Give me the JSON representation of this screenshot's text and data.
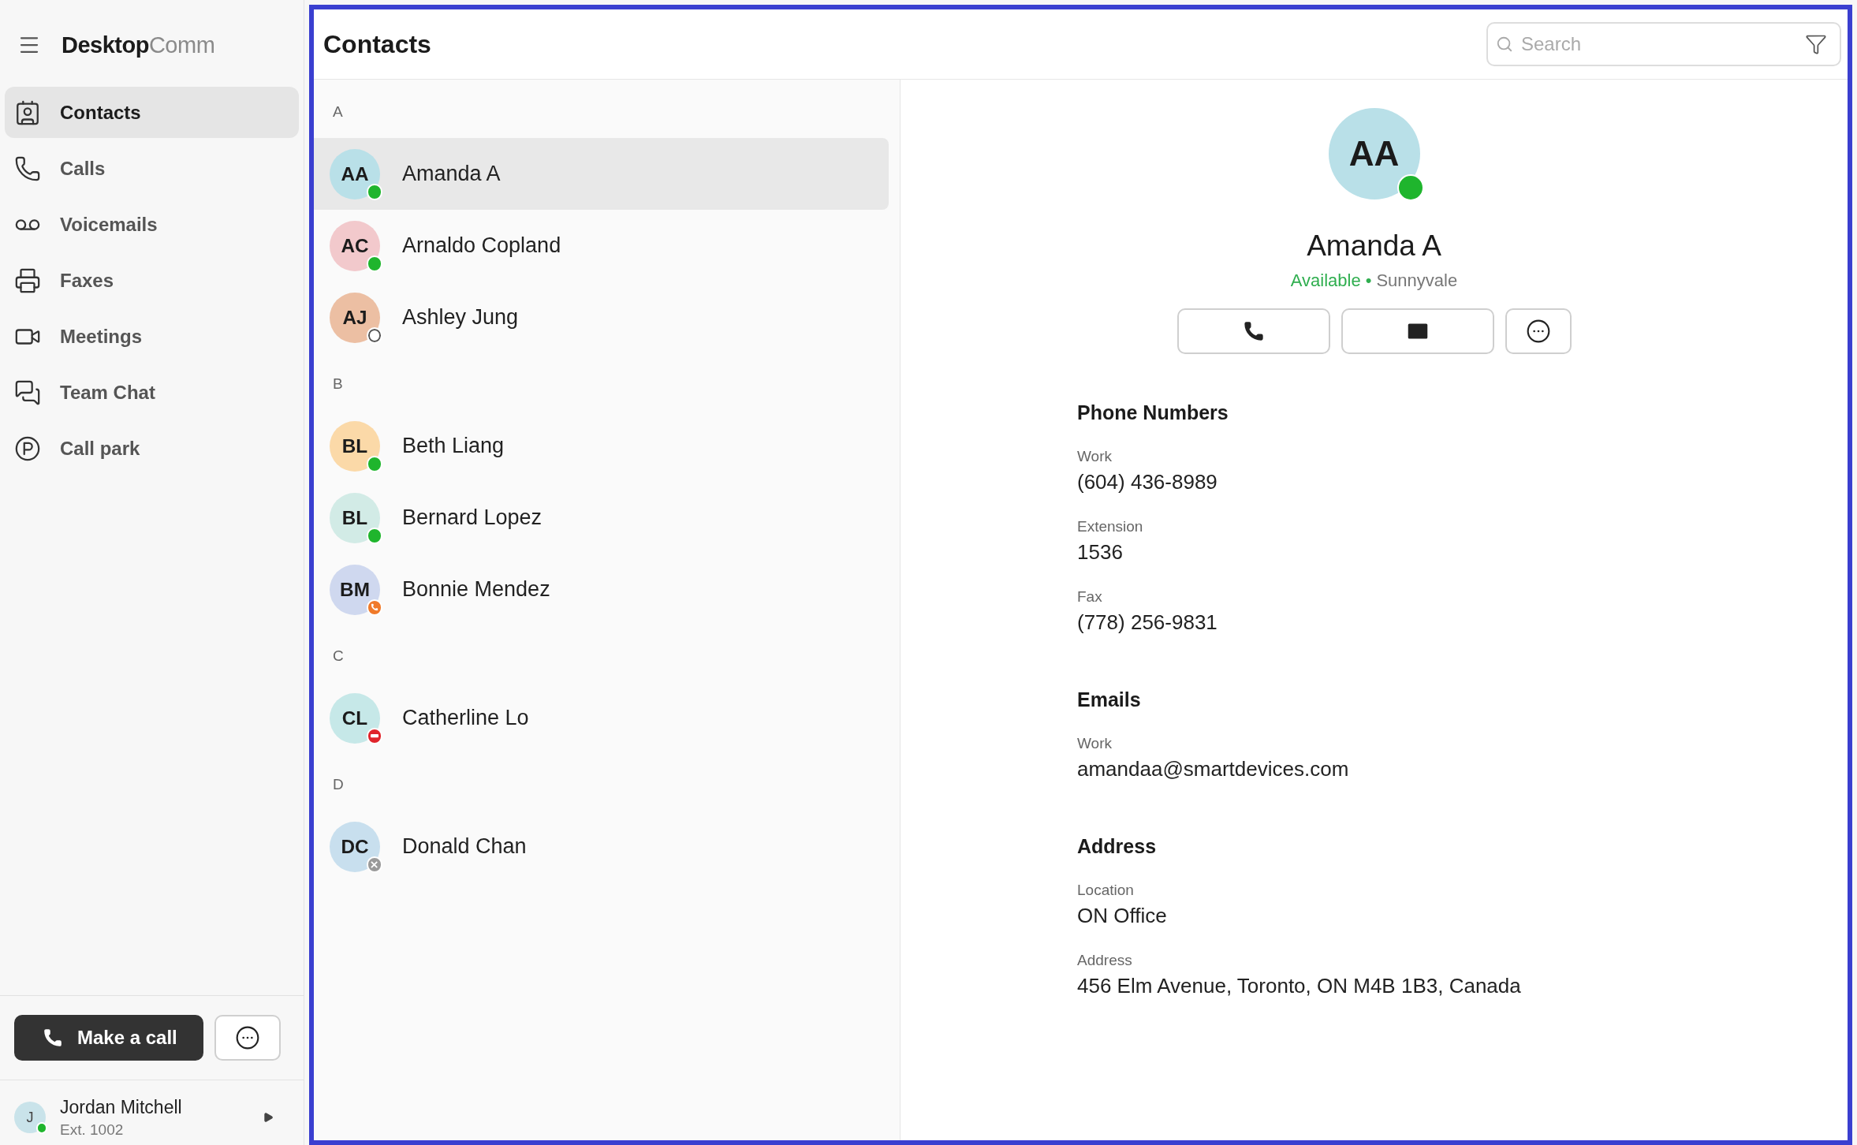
{
  "sidebar": {
    "brand": {
      "primary": "Desktop",
      "secondary": "Comm"
    },
    "items": [
      {
        "label": "Contacts",
        "kind": "contacts",
        "selected": true
      },
      {
        "label": "Calls",
        "kind": "calls",
        "selected": false
      },
      {
        "label": "Voicemails",
        "kind": "voicemails",
        "selected": false
      },
      {
        "label": "Faxes",
        "kind": "faxes",
        "selected": false
      },
      {
        "label": "Meetings",
        "kind": "meetings",
        "selected": false
      },
      {
        "label": "Team Chat",
        "kind": "chat",
        "selected": false
      },
      {
        "label": "Call park",
        "kind": "park",
        "selected": false
      }
    ],
    "make_call": {
      "label": "Make a call"
    },
    "user": {
      "initials": "J",
      "name": "Jordan Mitchell",
      "ext": "Ext. 1002",
      "status": {
        "kind": "available"
      }
    }
  },
  "header": {
    "title": "Contacts",
    "search": {
      "placeholder": "Search"
    }
  },
  "groups": [
    {
      "letter": "A",
      "contacts": [
        {
          "initials": "AA",
          "name": "Amanda A",
          "color": "#b9e0e8",
          "status": {
            "kind": "available"
          },
          "selected": true
        },
        {
          "initials": "AC",
          "name": "Arnaldo Copland",
          "color": "#f2c9cc",
          "status": {
            "kind": "available"
          },
          "selected": false
        },
        {
          "initials": "AJ",
          "name": "Ashley Jung",
          "color": "#ecbfa3",
          "status": {
            "kind": "offline"
          },
          "selected": false
        }
      ]
    },
    {
      "letter": "B",
      "contacts": [
        {
          "initials": "BL",
          "name": "Beth Liang",
          "color": "#fbd9a8",
          "status": {
            "kind": "available"
          },
          "selected": false
        },
        {
          "initials": "BL",
          "name": "Bernard Lopez",
          "color": "#d2ebe6",
          "status": {
            "kind": "available"
          },
          "selected": false
        },
        {
          "initials": "BM",
          "name": "Bonnie Mendez",
          "color": "#cfd8ef",
          "status": {
            "kind": "oncall"
          },
          "selected": false
        }
      ]
    },
    {
      "letter": "C",
      "contacts": [
        {
          "initials": "CL",
          "name": "Catherline Lo",
          "color": "#c6e8e8",
          "status": {
            "kind": "busy"
          },
          "selected": false
        }
      ]
    },
    {
      "letter": "D",
      "contacts": [
        {
          "initials": "DC",
          "name": "Donald Chan",
          "color": "#c8dfee",
          "status": {
            "kind": "unknown"
          },
          "selected": false
        }
      ]
    }
  ],
  "detail": {
    "initials": "AA",
    "color": "#b9e0e8",
    "status": {
      "kind": "available"
    },
    "name": "Amanda A",
    "availability": "Available",
    "separator": "•",
    "location": "Sunnyvale",
    "sections": [
      {
        "title": "Phone Numbers",
        "fields": [
          {
            "label": "Work",
            "value": "(604) 436-8989"
          },
          {
            "label": "Extension",
            "value": "1536"
          },
          {
            "label": "Fax",
            "value": "(778) 256-9831"
          }
        ]
      },
      {
        "title": "Emails",
        "fields": [
          {
            "label": "Work",
            "value": "amandaa@smartdevices.com"
          }
        ]
      },
      {
        "title": "Address",
        "fields": [
          {
            "label": "Location",
            "value": "ON Office"
          },
          {
            "label": "Address",
            "value": "456 Elm Avenue, Toronto, ON M4B 1B3, Canada"
          }
        ]
      }
    ]
  }
}
